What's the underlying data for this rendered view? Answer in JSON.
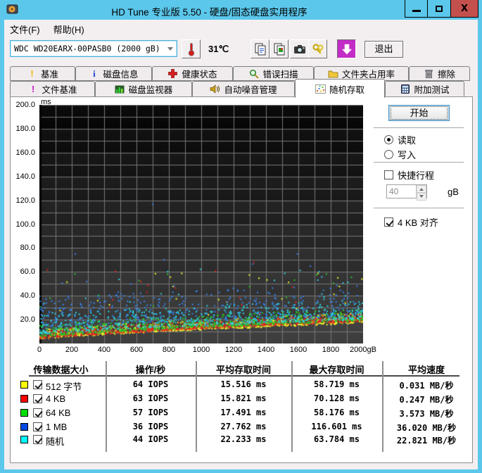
{
  "window": {
    "title": "HD Tune 专业版 5.50 - 硬盘/固态硬盘实用程序",
    "controls": [
      {
        "name": "minimize-icon"
      },
      {
        "name": "maximize-icon"
      },
      {
        "name": "close-icon"
      }
    ]
  },
  "menu": {
    "items": [
      {
        "label": "文件(F)"
      },
      {
        "label": "帮助(H)"
      }
    ]
  },
  "toolbar": {
    "drive_select": {
      "value": "WDC WD20EARX-00PASB0  (2000 gB)"
    },
    "temperature": "31℃",
    "buttons": [
      {
        "icon": "copy-text-icon"
      },
      {
        "icon": "copy-image-icon"
      },
      {
        "icon": "screenshot-camera-icon"
      },
      {
        "icon": "options-keys-icon"
      },
      {
        "icon": "save-results-icon",
        "pressed": true
      }
    ],
    "exit_label": "退出"
  },
  "tabs": {
    "row1": [
      {
        "label": "基准",
        "icon": "benchmark-icon"
      },
      {
        "label": "磁盘信息",
        "icon": "disk-info-icon"
      },
      {
        "label": "健康状态",
        "icon": "health-icon"
      },
      {
        "label": "错误扫描",
        "icon": "error-scan-icon"
      },
      {
        "label": "文件夹占用率",
        "icon": "folder-usage-icon"
      },
      {
        "label": "擦除",
        "icon": "erase-icon"
      }
    ],
    "row2": [
      {
        "label": "文件基准",
        "icon": "file-benchmark-icon"
      },
      {
        "label": "磁盘监视器",
        "icon": "disk-monitor-icon"
      },
      {
        "label": "自动噪音管理",
        "icon": "aam-icon"
      },
      {
        "label": "随机存取",
        "icon": "random-access-icon",
        "active": true
      },
      {
        "label": "附加测试",
        "icon": "extra-tests-icon"
      }
    ],
    "active": "随机存取"
  },
  "panel": {
    "start_label": "开始",
    "read_label": "读取",
    "read_selected": true,
    "write_label": "写入",
    "write_selected": false,
    "short_stroke_label": "快捷行程",
    "short_stroke_checked": false,
    "stroke_value": "40",
    "stroke_unit": "gB",
    "align_label": "4 KB 对齐",
    "align_checked": true
  },
  "chart_data": {
    "type": "scatter",
    "title": "",
    "xlabel": "",
    "ylabel": "ms",
    "xlim": [
      0,
      2000
    ],
    "ylim": [
      0,
      200
    ],
    "x_ticks": [
      "0",
      "200",
      "400",
      "600",
      "800",
      "1000",
      "1200",
      "1400",
      "1600",
      "1800",
      "2000gB"
    ],
    "y_ticks": [
      "200.0",
      "180.0",
      "160.0",
      "140.0",
      "120.0",
      "100.0",
      "80.0",
      "60.0",
      "40.0",
      "20.0"
    ],
    "grid": {
      "on": true,
      "x_step_gb": 100,
      "y_step_ms": 10,
      "color": "#787878"
    },
    "bg": {
      "top": "#000000",
      "bottom": "#3e3e3e"
    },
    "seed": 20131107,
    "series": [
      {
        "name": "512 字节",
        "color": "#f5f52a",
        "n": 700,
        "base_start": 4.0,
        "base_end": 17.5,
        "curve": 0.8,
        "spread": 8,
        "power": 2.2,
        "tail_prob": 0.04,
        "tail_max": 58.7,
        "avg_ms": 15.516,
        "max_ms": 58.719
      },
      {
        "name": "4 KB",
        "color": "#e82020",
        "n": 700,
        "base_start": 4.3,
        "base_end": 18.8,
        "curve": 0.8,
        "spread": 6,
        "power": 2.2,
        "tail_prob": 0.035,
        "tail_max": 70.1,
        "avg_ms": 15.821,
        "max_ms": 70.128
      },
      {
        "name": "64 KB",
        "color": "#28c828",
        "n": 620,
        "base_start": 5.5,
        "base_end": 19.5,
        "curve": 0.8,
        "spread": 10,
        "power": 2.0,
        "tail_prob": 0.045,
        "tail_max": 58.2,
        "avg_ms": 17.491,
        "max_ms": 58.176
      },
      {
        "name": "1 MB",
        "color": "#3584f0",
        "n": 430,
        "base_start": 14.0,
        "base_end": 23.0,
        "curve": 0.85,
        "spread": 26,
        "power": 1.6,
        "tail_prob": 0.06,
        "tail_max": 75.0,
        "avg_ms": 27.762,
        "max_ms": 116.601,
        "outliers": [
          {
            "x": 700,
            "ms": 116.6
          }
        ]
      },
      {
        "name": "随机",
        "color": "#2cd2e4",
        "n": 520,
        "base_start": 8.0,
        "base_end": 20.5,
        "curve": 0.8,
        "spread": 16,
        "power": 2.0,
        "tail_prob": 0.05,
        "tail_max": 63.8,
        "avg_ms": 22.233,
        "max_ms": 63.784
      }
    ]
  },
  "results": {
    "headers": [
      "传输数据大小",
      "操作/秒",
      "平均存取时间",
      "最大存取时间",
      "平均速度"
    ],
    "rows": [
      {
        "swatch": "#ffff00",
        "checked": true,
        "label": "512 字节",
        "iops": "64 IOPS",
        "avg": "15.516 ms",
        "max": "58.719 ms",
        "speed": "0.031 MB/秒"
      },
      {
        "swatch": "#ff0000",
        "checked": true,
        "label": "4 KB",
        "iops": "63 IOPS",
        "avg": "15.821 ms",
        "max": "70.128 ms",
        "speed": "0.247 MB/秒"
      },
      {
        "swatch": "#00dd00",
        "checked": true,
        "label": "64 KB",
        "iops": "57 IOPS",
        "avg": "17.491 ms",
        "max": "58.176 ms",
        "speed": "3.573 MB/秒"
      },
      {
        "swatch": "#0048e0",
        "checked": true,
        "label": "1 MB",
        "iops": "36 IOPS",
        "avg": "27.762 ms",
        "max": "116.601 ms",
        "speed": "36.020 MB/秒"
      },
      {
        "swatch": "#00ffff",
        "checked": true,
        "label": "随机",
        "iops": "44 IOPS",
        "avg": "22.233 ms",
        "max": "63.784 ms",
        "speed": "22.821 MB/秒"
      }
    ]
  }
}
